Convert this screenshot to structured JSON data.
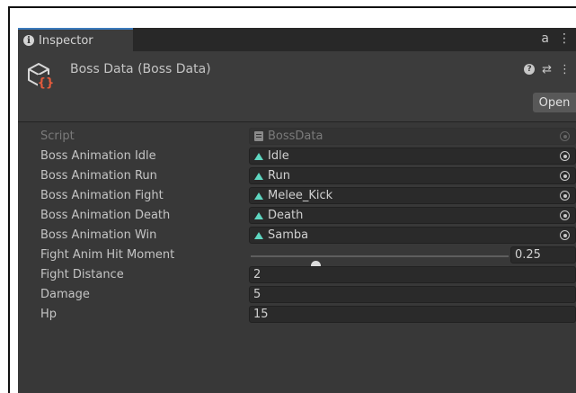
{
  "tab": {
    "label": "Inspector",
    "info_glyph": "i",
    "lock_glyph": "a",
    "menu_glyph": "⋮"
  },
  "header": {
    "title": "Boss Data (Boss Data)",
    "help_glyph": "?",
    "preset_glyph": "⇄",
    "menu_glyph": "⋮",
    "open_label": "Open"
  },
  "colors": {
    "accent_icon": "#e55b3c",
    "tab_highlight": "#3a79bb",
    "animation_icon": "#5fd6c0"
  },
  "fields": {
    "script": {
      "label": "Script",
      "value": "BossData"
    },
    "anim_idle": {
      "label": "Boss Animation Idle",
      "value": "Idle"
    },
    "anim_run": {
      "label": "Boss Animation Run",
      "value": "Run"
    },
    "anim_fight": {
      "label": "Boss Animation Fight",
      "value": "Melee_Kick"
    },
    "anim_death": {
      "label": "Boss Animation Death",
      "value": "Death"
    },
    "anim_win": {
      "label": "Boss Animation Win",
      "value": "Samba"
    },
    "hit_moment": {
      "label": "Fight Anim Hit Moment",
      "value": "0.25",
      "fraction": 0.25
    },
    "fight_distance": {
      "label": "Fight Distance",
      "value": "2"
    },
    "damage": {
      "label": "Damage",
      "value": "5"
    },
    "hp": {
      "label": "Hp",
      "value": "15"
    }
  }
}
